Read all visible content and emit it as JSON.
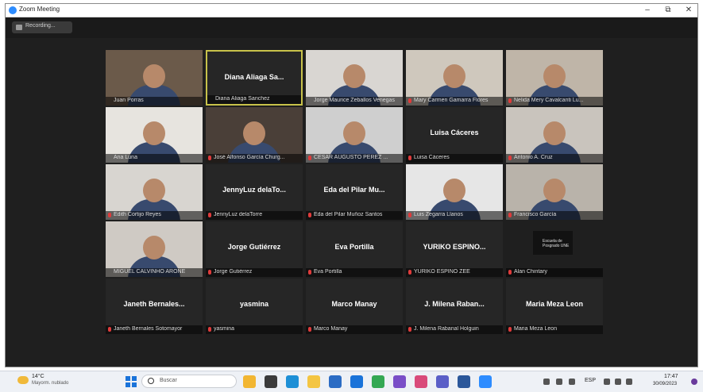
{
  "window": {
    "title": "Zoom Meeting",
    "controls": [
      "–",
      "⧉",
      "✕"
    ]
  },
  "recording": {
    "label": "Recording..."
  },
  "participants": [
    {
      "display": "",
      "name": "Juan Porras",
      "video": true,
      "bg": "#6b5a4a",
      "active": false,
      "muted": false
    },
    {
      "display": "Diana Aliaga Sa...",
      "name": "Diana Aliaga Sanchez",
      "video": false,
      "bg": "#262626",
      "active": true,
      "muted": false
    },
    {
      "display": "",
      "name": "Jorge Maurice Zeballos Venegas",
      "video": true,
      "bg": "#d9d6d2",
      "active": false,
      "muted": false
    },
    {
      "display": "",
      "name": "Mary Carmen Gamarra Flores",
      "video": true,
      "bg": "#cfc8bd",
      "active": false,
      "muted": true
    },
    {
      "display": "",
      "name": "Nelida Mery Cavalcanti Lu...",
      "video": true,
      "bg": "#bfb5a8",
      "active": false,
      "muted": true
    },
    {
      "display": "",
      "name": "Ana Luna",
      "video": true,
      "bg": "#e7e4df",
      "active": false,
      "muted": false
    },
    {
      "display": "",
      "name": "José Alfonso García Churg...",
      "video": true,
      "bg": "#4a3f38",
      "active": false,
      "muted": true
    },
    {
      "display": "",
      "name": "CESAR AUGUSTO PEREZ ...",
      "video": true,
      "bg": "#cfcfcf",
      "active": false,
      "muted": true
    },
    {
      "display": "Luisa Cáceres",
      "name": "Luisa Cáceres",
      "video": false,
      "bg": "#262626",
      "active": false,
      "muted": true
    },
    {
      "display": "",
      "name": "Antonio A. Cruz",
      "video": true,
      "bg": "#c9c4bd",
      "active": false,
      "muted": true
    },
    {
      "display": "",
      "name": "Edith Cortijo Reyes",
      "video": true,
      "bg": "#d8d5d0",
      "active": false,
      "muted": true
    },
    {
      "display": "JennyLuz delaTo...",
      "name": "JennyLuz delaTorre",
      "video": false,
      "bg": "#262626",
      "active": false,
      "muted": true
    },
    {
      "display": "Eda del Pilar Mu...",
      "name": "Eda del Pilar Muñoz Santos",
      "video": false,
      "bg": "#262626",
      "active": false,
      "muted": true
    },
    {
      "display": "",
      "name": "Luis Zegarra Llanos",
      "video": true,
      "bg": "#e6e6e6",
      "active": false,
      "muted": true
    },
    {
      "display": "",
      "name": "Francisco García",
      "video": true,
      "bg": "#b9b3aa",
      "active": false,
      "muted": true
    },
    {
      "display": "",
      "name": "MIGUEL CALVINHO ARONE",
      "video": true,
      "bg": "#cfcac4",
      "active": false,
      "muted": false
    },
    {
      "display": "Jorge Gutiérrez",
      "name": "Jorge Gutiérrez",
      "video": false,
      "bg": "#262626",
      "active": false,
      "muted": true
    },
    {
      "display": "Eva Portilla",
      "name": "Eva Portilla",
      "video": false,
      "bg": "#262626",
      "active": false,
      "muted": true
    },
    {
      "display": "YURIKO ESPINO...",
      "name": "YURIKO ESPINO ZEE",
      "video": false,
      "bg": "#262626",
      "active": false,
      "muted": true
    },
    {
      "display": "",
      "name": "Alan Chintary",
      "video": true,
      "bg": "#1f1f1f",
      "active": false,
      "muted": true,
      "logo": "Escuela de Posgrado UNE"
    },
    {
      "display": "Janeth Bernales...",
      "name": "Janeth Bernales Sotomayor",
      "video": false,
      "bg": "#262626",
      "active": false,
      "muted": true
    },
    {
      "display": "yasmina",
      "name": "yasmina",
      "video": false,
      "bg": "#262626",
      "active": false,
      "muted": true
    },
    {
      "display": "Marco Manay",
      "name": "Marco Manay",
      "video": false,
      "bg": "#262626",
      "active": false,
      "muted": true
    },
    {
      "display": "J. Milena Raban...",
      "name": "J. Milena Rabanal Holguin",
      "video": false,
      "bg": "#262626",
      "active": false,
      "muted": true
    },
    {
      "display": "Maria Meza Leon",
      "name": "Maria Meza Leon",
      "video": false,
      "bg": "#262626",
      "active": false,
      "muted": true
    }
  ],
  "taskbar": {
    "weather_temp": "14°C",
    "weather_desc": "Mayorm. nublado",
    "search_placeholder": "Buscar",
    "apps": [
      {
        "name": "file-explorer-icon",
        "color": "#f2b632"
      },
      {
        "name": "task-view-icon",
        "color": "#3b3b3b"
      },
      {
        "name": "edge-icon",
        "color": "#1d8fd6"
      },
      {
        "name": "folder-icon",
        "color": "#f4c542"
      },
      {
        "name": "store-icon",
        "color": "#2b6cc4"
      },
      {
        "name": "mail-icon",
        "color": "#1a73d9"
      },
      {
        "name": "chrome-icon",
        "color": "#34a853"
      },
      {
        "name": "media-icon",
        "color": "#7a4ec7"
      },
      {
        "name": "photos-icon",
        "color": "#d94a7a"
      },
      {
        "name": "teams-icon",
        "color": "#5b5fc7"
      },
      {
        "name": "word-icon",
        "color": "#2b579a"
      },
      {
        "name": "zoom-icon",
        "color": "#2d8cff"
      }
    ],
    "lang": "ESP",
    "time": "17:47",
    "date": "30/09/2023"
  }
}
